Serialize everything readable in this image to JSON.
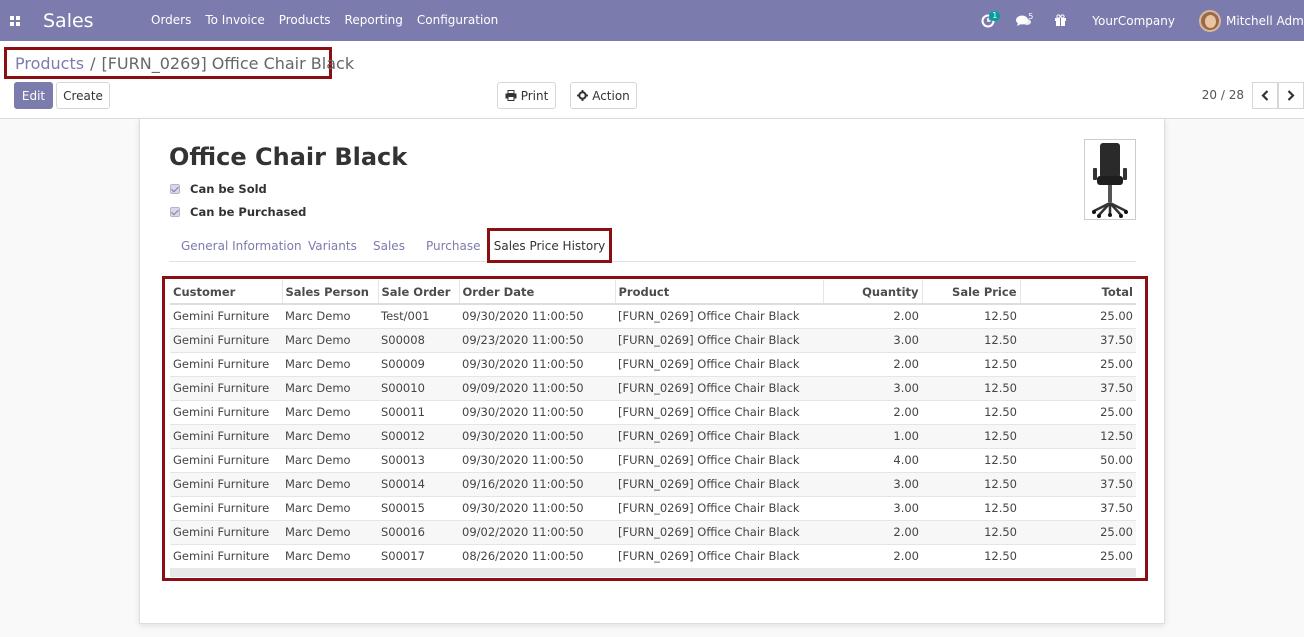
{
  "navbar": {
    "app_name": "Sales",
    "menu": [
      "Orders",
      "To Invoice",
      "Products",
      "Reporting",
      "Configuration"
    ],
    "activity_count": "1",
    "messages_count": "5",
    "company": "YourCompany",
    "user": "Mitchell Admin"
  },
  "breadcrumb": {
    "parent": "Products",
    "separator": "/",
    "current": "[FURN_0269] Office Chair Black"
  },
  "buttons": {
    "edit": "Edit",
    "create": "Create",
    "print": "Print",
    "action": "Action"
  },
  "pager": {
    "value": "20 / 28"
  },
  "product": {
    "name": "Office Chair Black",
    "can_be_sold": "Can be Sold",
    "can_be_purchased": "Can be Purchased"
  },
  "tabs": [
    "General Information",
    "Variants",
    "Sales",
    "Purchase"
  ],
  "active_tab": "Sales Price History",
  "table": {
    "headers": [
      "Customer",
      "Sales Person",
      "Sale Order",
      "Order Date",
      "Product",
      "Quantity",
      "Sale Price",
      "Total"
    ],
    "rows": [
      [
        "Gemini Furniture",
        "Marc Demo",
        "Test/001",
        "09/30/2020 11:00:50",
        "[FURN_0269] Office Chair Black",
        "2.00",
        "12.50",
        "25.00"
      ],
      [
        "Gemini Furniture",
        "Marc Demo",
        "S00008",
        "09/23/2020 11:00:50",
        "[FURN_0269] Office Chair Black",
        "3.00",
        "12.50",
        "37.50"
      ],
      [
        "Gemini Furniture",
        "Marc Demo",
        "S00009",
        "09/30/2020 11:00:50",
        "[FURN_0269] Office Chair Black",
        "2.00",
        "12.50",
        "25.00"
      ],
      [
        "Gemini Furniture",
        "Marc Demo",
        "S00010",
        "09/09/2020 11:00:50",
        "[FURN_0269] Office Chair Black",
        "3.00",
        "12.50",
        "37.50"
      ],
      [
        "Gemini Furniture",
        "Marc Demo",
        "S00011",
        "09/30/2020 11:00:50",
        "[FURN_0269] Office Chair Black",
        "2.00",
        "12.50",
        "25.00"
      ],
      [
        "Gemini Furniture",
        "Marc Demo",
        "S00012",
        "09/30/2020 11:00:50",
        "[FURN_0269] Office Chair Black",
        "1.00",
        "12.50",
        "12.50"
      ],
      [
        "Gemini Furniture",
        "Marc Demo",
        "S00013",
        "09/30/2020 11:00:50",
        "[FURN_0269] Office Chair Black",
        "4.00",
        "12.50",
        "50.00"
      ],
      [
        "Gemini Furniture",
        "Marc Demo",
        "S00014",
        "09/16/2020 11:00:50",
        "[FURN_0269] Office Chair Black",
        "3.00",
        "12.50",
        "37.50"
      ],
      [
        "Gemini Furniture",
        "Marc Demo",
        "S00015",
        "09/30/2020 11:00:50",
        "[FURN_0269] Office Chair Black",
        "3.00",
        "12.50",
        "37.50"
      ],
      [
        "Gemini Furniture",
        "Marc Demo",
        "S00016",
        "09/02/2020 11:00:50",
        "[FURN_0269] Office Chair Black",
        "2.00",
        "12.50",
        "25.00"
      ],
      [
        "Gemini Furniture",
        "Marc Demo",
        "S00017",
        "08/26/2020 11:00:50",
        "[FURN_0269] Office Chair Black",
        "2.00",
        "12.50",
        "25.00"
      ]
    ]
  },
  "colors": {
    "brand": "#7c7bad",
    "highlight": "#8b0e12"
  }
}
